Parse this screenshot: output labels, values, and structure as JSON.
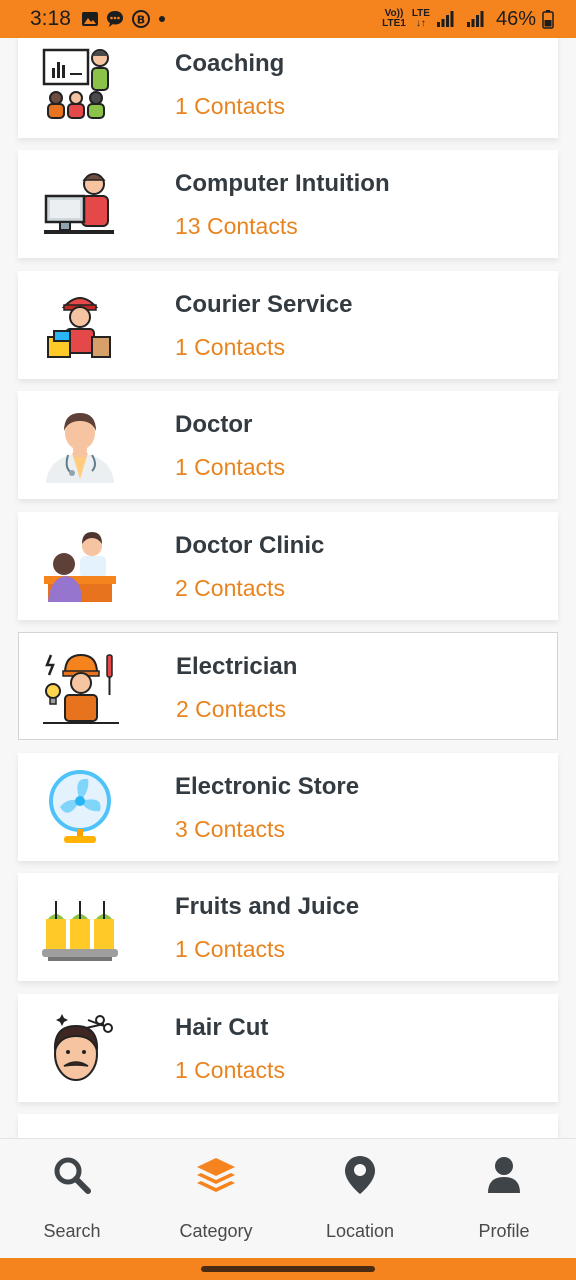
{
  "status_bar": {
    "time": "3:18",
    "network_top": "Vo))",
    "network_bottom": "LTE1",
    "lte_label": "LTE",
    "battery": "46%"
  },
  "categories": [
    {
      "name": "Coaching",
      "count": "1 Contacts",
      "icon": "teacher-icon"
    },
    {
      "name": "Computer Intuition",
      "count": "13 Contacts",
      "icon": "computer-user-icon"
    },
    {
      "name": "Courier Service",
      "count": "1 Contacts",
      "icon": "courier-icon"
    },
    {
      "name": "Doctor",
      "count": "1 Contacts",
      "icon": "doctor-icon"
    },
    {
      "name": "Doctor Clinic",
      "count": "2 Contacts",
      "icon": "clinic-icon"
    },
    {
      "name": "Electrician",
      "count": "2 Contacts",
      "icon": "electrician-icon"
    },
    {
      "name": "Electronic Store",
      "count": "3 Contacts",
      "icon": "fan-icon"
    },
    {
      "name": "Fruits and Juice",
      "count": "1 Contacts",
      "icon": "juice-icon"
    },
    {
      "name": "Hair Cut",
      "count": "1 Contacts",
      "icon": "barber-icon"
    }
  ],
  "nav": {
    "items": [
      {
        "label": "Search",
        "icon": "search-icon"
      },
      {
        "label": "Category",
        "icon": "layers-icon",
        "active": true
      },
      {
        "label": "Location",
        "icon": "location-pin-icon"
      },
      {
        "label": "Profile",
        "icon": "profile-icon"
      }
    ]
  },
  "colors": {
    "accent": "#f5841f",
    "count_text": "#e8841f",
    "title_text": "#333b41",
    "nav_active": "#f5841f",
    "nav_inactive": "#3f4448"
  }
}
